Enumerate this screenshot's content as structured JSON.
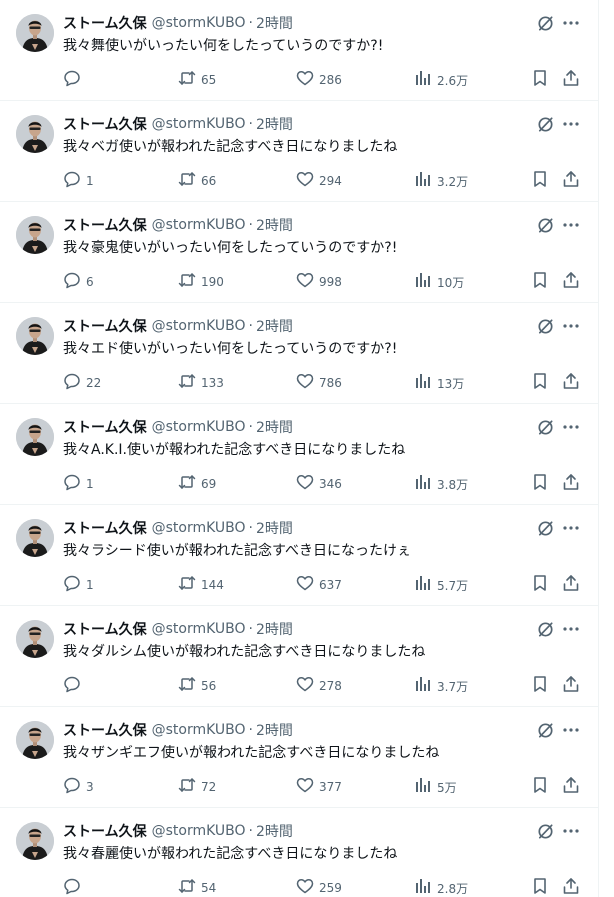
{
  "tweets": [
    {
      "name": "ストーム久保",
      "handle": "@stormKUBO",
      "dot": "·",
      "time": "2時間",
      "text": "我々舞使いがいったい何をしたっていうのですか?!",
      "replies": "",
      "retweets": "65",
      "likes": "286",
      "views": "2.6万"
    },
    {
      "name": "ストーム久保",
      "handle": "@stormKUBO",
      "dot": "·",
      "time": "2時間",
      "text": "我々ベガ使いが報われた記念すべき日になりましたね",
      "replies": "1",
      "retweets": "66",
      "likes": "294",
      "views": "3.2万"
    },
    {
      "name": "ストーム久保",
      "handle": "@stormKUBO",
      "dot": "·",
      "time": "2時間",
      "text": "我々豪鬼使いがいったい何をしたっていうのですか?!",
      "replies": "6",
      "retweets": "190",
      "likes": "998",
      "views": "10万"
    },
    {
      "name": "ストーム久保",
      "handle": "@stormKUBO",
      "dot": "·",
      "time": "2時間",
      "text": "我々エド使いがいったい何をしたっていうのですか?!",
      "replies": "22",
      "retweets": "133",
      "likes": "786",
      "views": "13万"
    },
    {
      "name": "ストーム久保",
      "handle": "@stormKUBO",
      "dot": "·",
      "time": "2時間",
      "text": "我々A.K.I.使いが報われた記念すべき日になりましたね",
      "replies": "1",
      "retweets": "69",
      "likes": "346",
      "views": "3.8万"
    },
    {
      "name": "ストーム久保",
      "handle": "@stormKUBO",
      "dot": "·",
      "time": "2時間",
      "text": "我々ラシード使いが報われた記念すべき日になったけぇ",
      "replies": "1",
      "retweets": "144",
      "likes": "637",
      "views": "5.7万"
    },
    {
      "name": "ストーム久保",
      "handle": "@stormKUBO",
      "dot": "·",
      "time": "2時間",
      "text": "我々ダルシム使いが報われた記念すべき日になりましたね",
      "replies": "",
      "retweets": "56",
      "likes": "278",
      "views": "3.7万"
    },
    {
      "name": "ストーム久保",
      "handle": "@stormKUBO",
      "dot": "·",
      "time": "2時間",
      "text": "我々ザンギエフ使いが報われた記念すべき日になりましたね",
      "replies": "3",
      "retweets": "72",
      "likes": "377",
      "views": "5万"
    },
    {
      "name": "ストーム久保",
      "handle": "@stormKUBO",
      "dot": "·",
      "time": "2時間",
      "text": "我々春麗使いが報われた記念すべき日になりましたね",
      "replies": "",
      "retweets": "54",
      "likes": "259",
      "views": "2.8万"
    }
  ],
  "colors": {
    "text": "#0f1419",
    "secondary": "#536471",
    "border": "#eff3f4",
    "background": "#ffffff"
  },
  "icons": [
    "grok-icon",
    "more-icon",
    "reply-icon",
    "retweet-icon",
    "like-icon",
    "views-icon",
    "bookmark-icon",
    "share-icon"
  ]
}
